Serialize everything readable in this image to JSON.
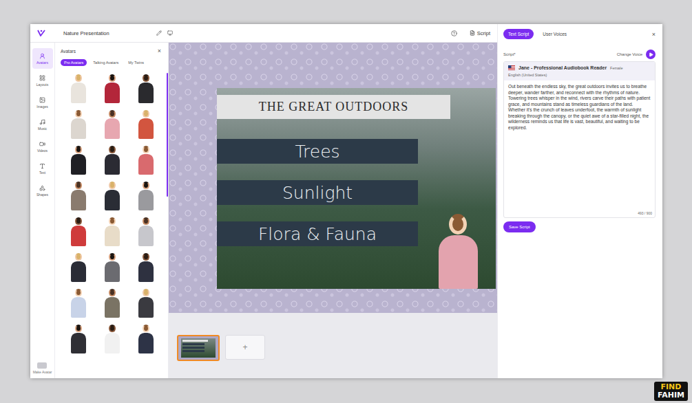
{
  "window": {
    "title": "Nature Presentation"
  },
  "toolbar": {
    "script_button": "Script"
  },
  "rail": {
    "items": [
      {
        "label": "Avatars",
        "selected": true
      },
      {
        "label": "Layouts",
        "selected": false
      },
      {
        "label": "Images",
        "selected": false
      },
      {
        "label": "Music",
        "selected": false
      },
      {
        "label": "Videos",
        "selected": false
      },
      {
        "label": "Text",
        "selected": false
      },
      {
        "label": "Shapes",
        "selected": false
      }
    ],
    "bottom": "Make Avatar"
  },
  "avatar_panel": {
    "title": "Avatars",
    "close": "×",
    "tabs": [
      {
        "label": "Pro Avatars",
        "selected": true
      },
      {
        "label": "Talking Avatars",
        "selected": false
      },
      {
        "label": "My Twins",
        "selected": false
      }
    ]
  },
  "slide": {
    "title": "THE GREAT OUTDOORS",
    "items": [
      "Trees",
      "Sunlight",
      "Flora & Fauna"
    ]
  },
  "thumbnails": {
    "slides": [
      {
        "selected": true
      }
    ],
    "add": "+"
  },
  "script_panel": {
    "tabs": [
      {
        "label": "Text Script",
        "selected": true
      },
      {
        "label": "User Voices",
        "selected": false
      }
    ],
    "close": "×",
    "label": "Script*",
    "change_voice": "Change Voice",
    "voice": {
      "name": "Jane - Professional Audiobook Reader",
      "gender": "Female",
      "language": "English (United States)"
    },
    "text": "Out beneath the endless sky, the great outdoors invites us to breathe deeper, wander farther, and reconnect with the rhythms of nature. Towering trees whisper in the wind, rivers carve their paths with patient grace, and mountains stand as timeless guardians of the land. Whether it's the crunch of leaves underfoot, the warmth of sunlight breaking through the canopy, or the quiet awe of a star-filled night, the wilderness reminds us that life is vast, beautiful, and waiting to be explored.",
    "counter": "493 / 900",
    "save": "Save Script"
  },
  "watermark": {
    "line1": "FIND",
    "line2": "FAHIM"
  }
}
